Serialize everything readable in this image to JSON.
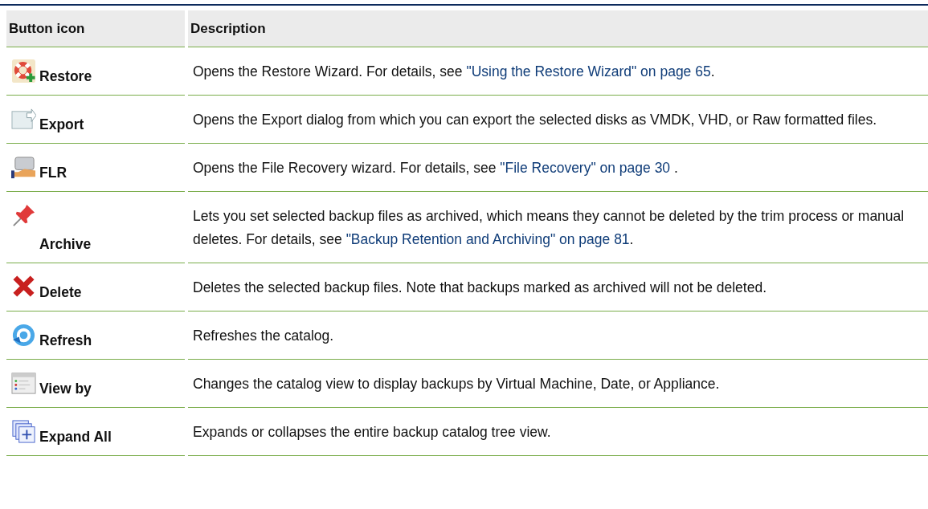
{
  "table": {
    "columns": [
      "Button icon",
      "Description"
    ],
    "rows": [
      {
        "kind": "lifebuoy",
        "label": "Restore",
        "description": [
          {
            "kind": "text",
            "text": "Opens the Restore Wizard. For details, see "
          },
          {
            "kind": "link",
            "text": "\"Using the Restore Wizard\" on page 65"
          },
          {
            "kind": "text",
            "text": "."
          }
        ]
      },
      {
        "kind": "export",
        "label": "Export",
        "description": [
          {
            "kind": "text",
            "text": "Opens the Export dialog from which you can export the selected disks as VMDK, VHD, or Raw formatted files."
          }
        ]
      },
      {
        "kind": "drive",
        "label": "FLR",
        "description": [
          {
            "kind": "text",
            "text": "Opens the File Recovery wizard. For details, see "
          },
          {
            "kind": "link",
            "text": "\"File Recovery\" on page 30"
          },
          {
            "kind": "text",
            "text": " ."
          }
        ]
      },
      {
        "kind": "pin",
        "label": "Archive",
        "description": [
          {
            "kind": "text",
            "text": "Lets you set selected backup files as archived, which means they cannot be deleted by the trim process or manual deletes. For details, see "
          },
          {
            "kind": "link",
            "text": "\"Backup Retention and Archiving\" on page 81"
          },
          {
            "kind": "text",
            "text": "."
          }
        ]
      },
      {
        "kind": "cross",
        "label": "Delete",
        "description": [
          {
            "kind": "text",
            "text": "Deletes the selected backup files. Note that backups marked as archived will not be deleted."
          }
        ]
      },
      {
        "kind": "refresh",
        "label": "Refresh",
        "description": [
          {
            "kind": "text",
            "text": "Refreshes the catalog."
          }
        ]
      },
      {
        "kind": "list",
        "label": "View by",
        "description": [
          {
            "kind": "text",
            "text": "Changes the catalog view to display backups by Virtual Machine, Date, or Appliance."
          }
        ]
      },
      {
        "kind": "expand",
        "label": "Expand All",
        "description": [
          {
            "kind": "text",
            "text": "Expands or collapses the entire backup catalog tree view."
          }
        ]
      }
    ]
  }
}
